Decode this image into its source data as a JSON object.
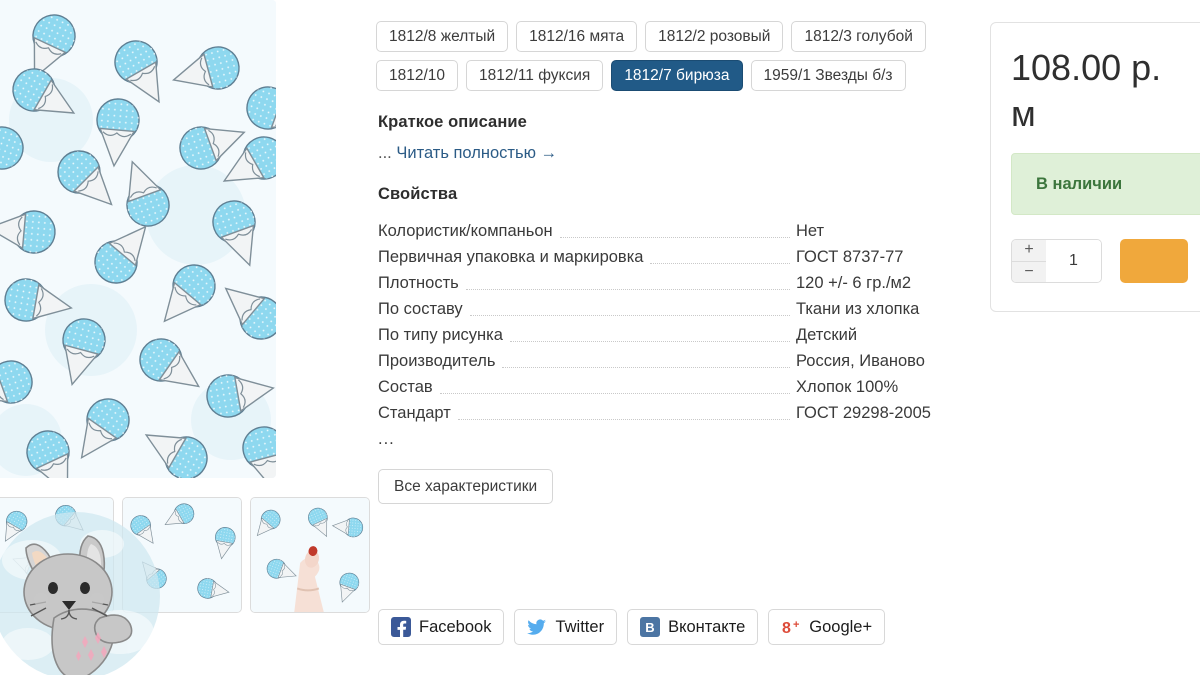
{
  "gallery": {
    "main_image_alt": "Ткань с рисунком мороженое, бирюзовая",
    "thumbnails": [
      {
        "alt": "Ткань крупным планом"
      },
      {
        "alt": "Ткань с рисунком мороженое"
      },
      {
        "alt": "Рука на ткани"
      }
    ],
    "watermark": "bunny-mascot"
  },
  "variants": {
    "row1": [
      {
        "label": "1812/8 желтый",
        "selected": false
      },
      {
        "label": "1812/16 мята",
        "selected": false
      },
      {
        "label": "1812/2 розовый",
        "selected": false
      },
      {
        "label": "1812/3 голубой",
        "selected": false
      }
    ],
    "row2": [
      {
        "label": "1812/10",
        "selected": false
      },
      {
        "label": "1812/11 фуксия",
        "selected": false
      },
      {
        "label": "1812/7 бирюза",
        "selected": true
      },
      {
        "label": "1959/1 Звезды б/з",
        "selected": false
      }
    ]
  },
  "description": {
    "heading": "Краткое описание",
    "ellipsis": "...",
    "read_more": "Читать полностью",
    "arrow": "→"
  },
  "properties": {
    "heading": "Свойства",
    "rows": [
      {
        "name": "Колористик/компаньон",
        "value": "Нет"
      },
      {
        "name": "Первичная упаковка и маркировка",
        "value": "ГОСТ 8737-77"
      },
      {
        "name": "Плотность",
        "value": "120 +/- 6 гр./м2"
      },
      {
        "name": "По составу",
        "value": "Ткани из хлопка"
      },
      {
        "name": "По типу рисунка",
        "value": "Детский"
      },
      {
        "name": "Производитель",
        "value": "Россия, Иваново"
      },
      {
        "name": "Состав",
        "value": "Хлопок 100%"
      },
      {
        "name": "Стандарт",
        "value": "ГОСТ 29298-2005"
      }
    ],
    "more_ellipsis": "...",
    "all_chars_button": "Все характеристики"
  },
  "social": [
    {
      "label": "Facebook",
      "icon": "facebook-icon",
      "color": "#3b5998"
    },
    {
      "label": "Twitter",
      "icon": "twitter-icon",
      "color": "#55acee"
    },
    {
      "label": "Вконтакте",
      "icon": "vk-icon",
      "color": "#4c75a3"
    },
    {
      "label": "Google+",
      "icon": "google-plus-icon",
      "color": "#dd4b39"
    }
  ],
  "buy_panel": {
    "price": "108.00 р. м",
    "stock_status": "В наличии",
    "stock_bg": "#dff0d8",
    "stock_color": "#3c763d",
    "quantity": "1",
    "increment": "+",
    "decrement": "−",
    "cart_button_color": "#f0a83c",
    "cart_button_label": ""
  },
  "colors": {
    "selected_variant_bg": "#215a87",
    "link": "#2b5b86",
    "fabric_bg": "#f4fafd",
    "ice_cream": "#8ed8ef"
  }
}
